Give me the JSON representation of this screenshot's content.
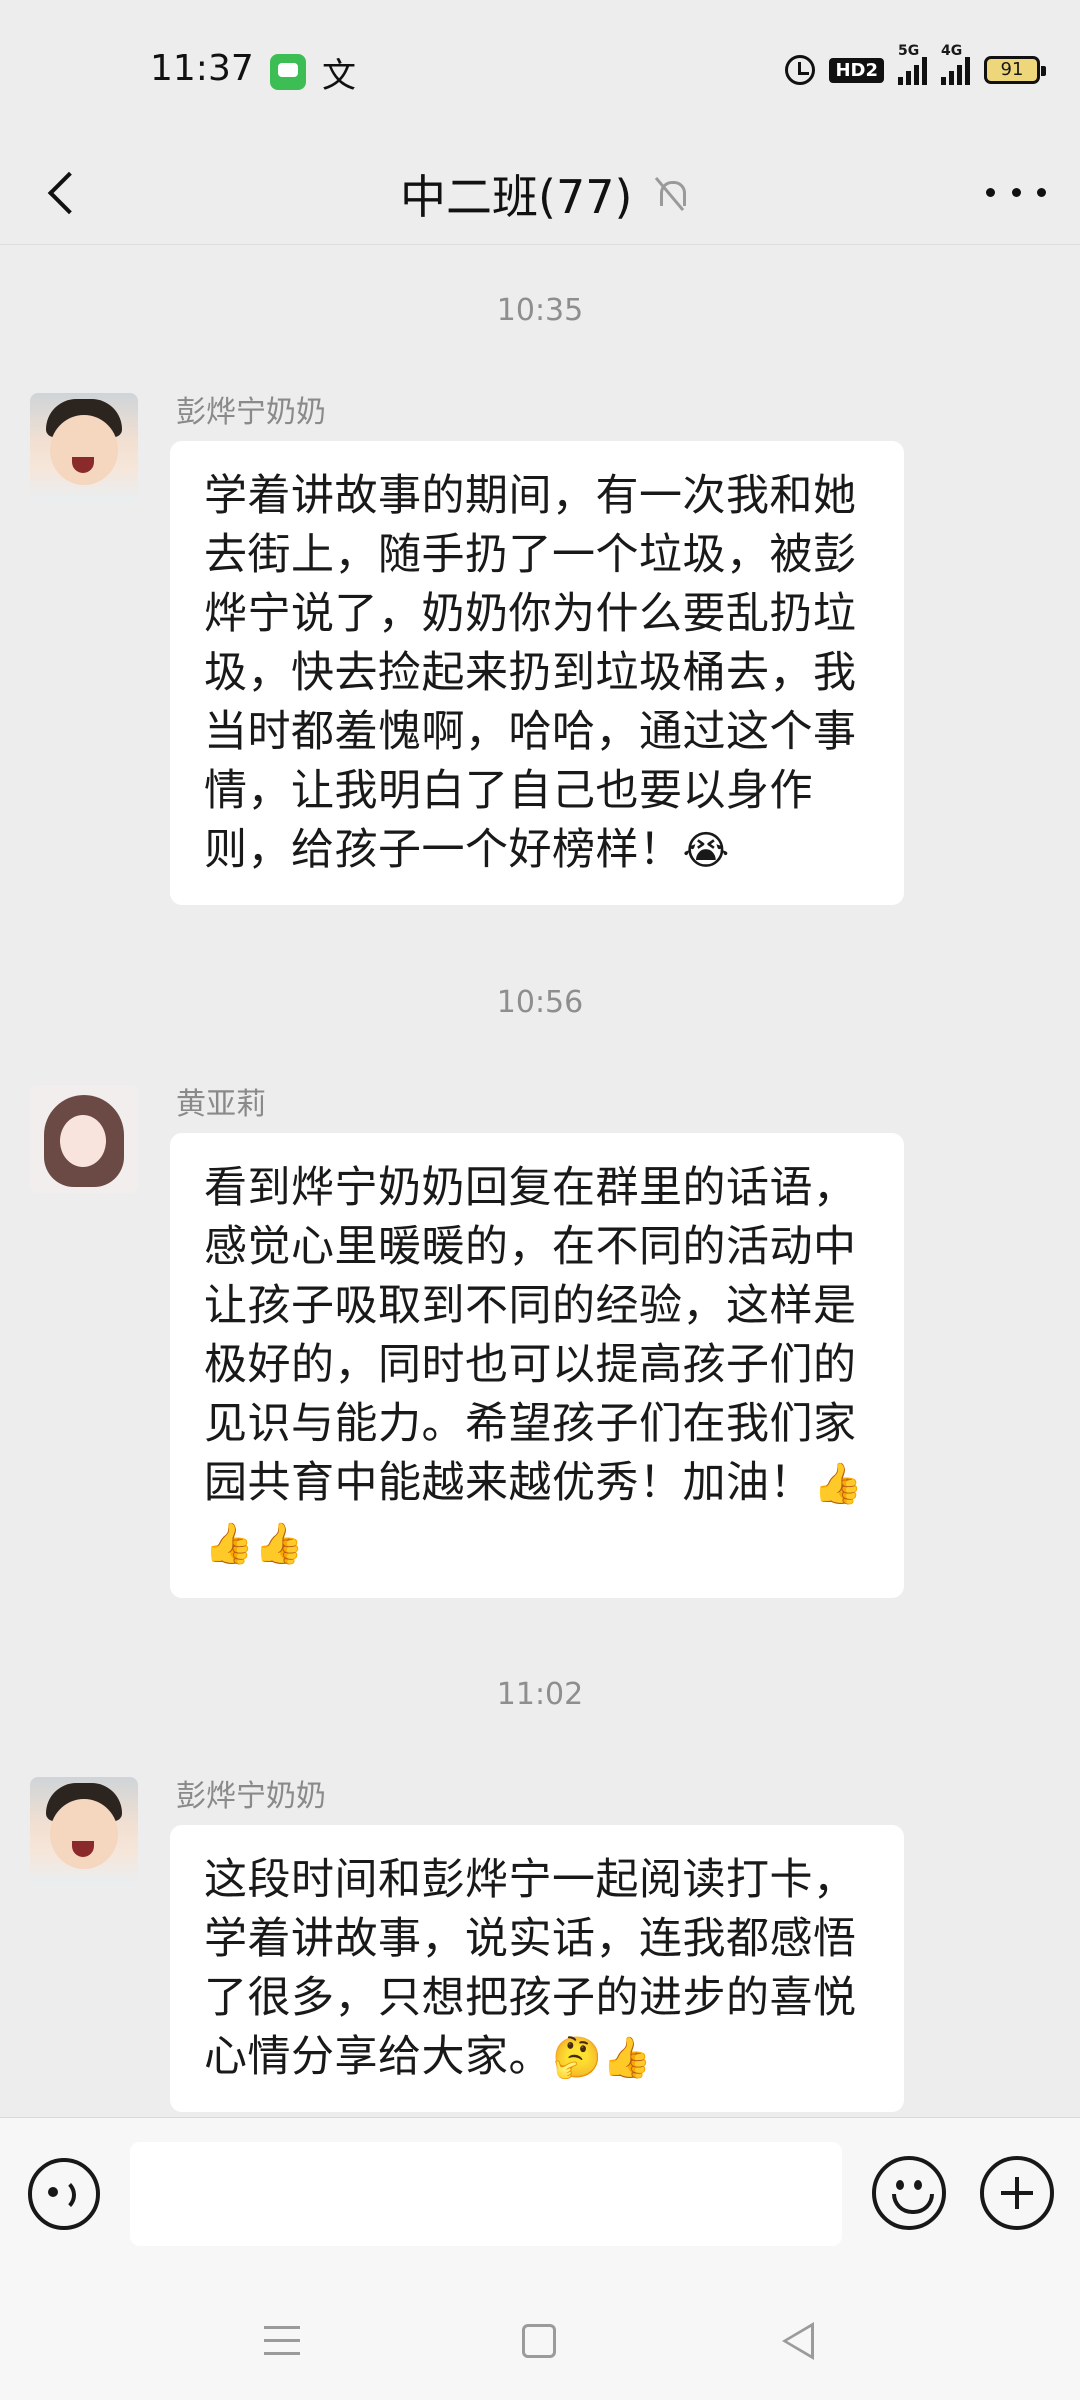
{
  "status_bar": {
    "time": "11:37",
    "ime_label": "文",
    "hd_label": "HD2",
    "signal1_label": "5G",
    "signal2_label": "4G",
    "battery": "91"
  },
  "header": {
    "title": "中二班(77)"
  },
  "messages": [
    {
      "time": "10:35",
      "sender": "彭烨宁奶奶",
      "text": "学着讲故事的期间，有一次我和她去街上，随手扔了一个垃圾，被彭烨宁说了，奶奶你为什么要乱扔垃圾，快去捡起来扔到垃圾桶去，我当时都羞愧啊，哈哈，通过这个事情，让我明白了自己也要以身作则，给孩子一个好榜样！",
      "emoji": "😭"
    },
    {
      "time": "10:56",
      "sender": "黄亚莉",
      "text": "看到烨宁奶奶回复在群里的话语，感觉心里暖暖的，在不同的活动中让孩子吸取到不同的经验，这样是极好的，同时也可以提高孩子们的见识与能力。希望孩子们在我们家园共育中能越来越优秀！加油！",
      "emoji": "👍👍👍"
    },
    {
      "time": "11:02",
      "sender": "彭烨宁奶奶",
      "text": "这段时间和彭烨宁一起阅读打卡，学着讲故事，说实话，连我都感悟了很多，只想把孩子的进步的喜悦心情分享给大家。",
      "emoji": "🤔👍"
    }
  ],
  "input": {
    "value": ""
  },
  "icons": {
    "back": "back-arrow-icon",
    "mute": "bell-off-icon",
    "more": "more-dots-icon",
    "voice": "voice-icon",
    "emoji": "emoji-icon",
    "plus": "plus-icon"
  }
}
